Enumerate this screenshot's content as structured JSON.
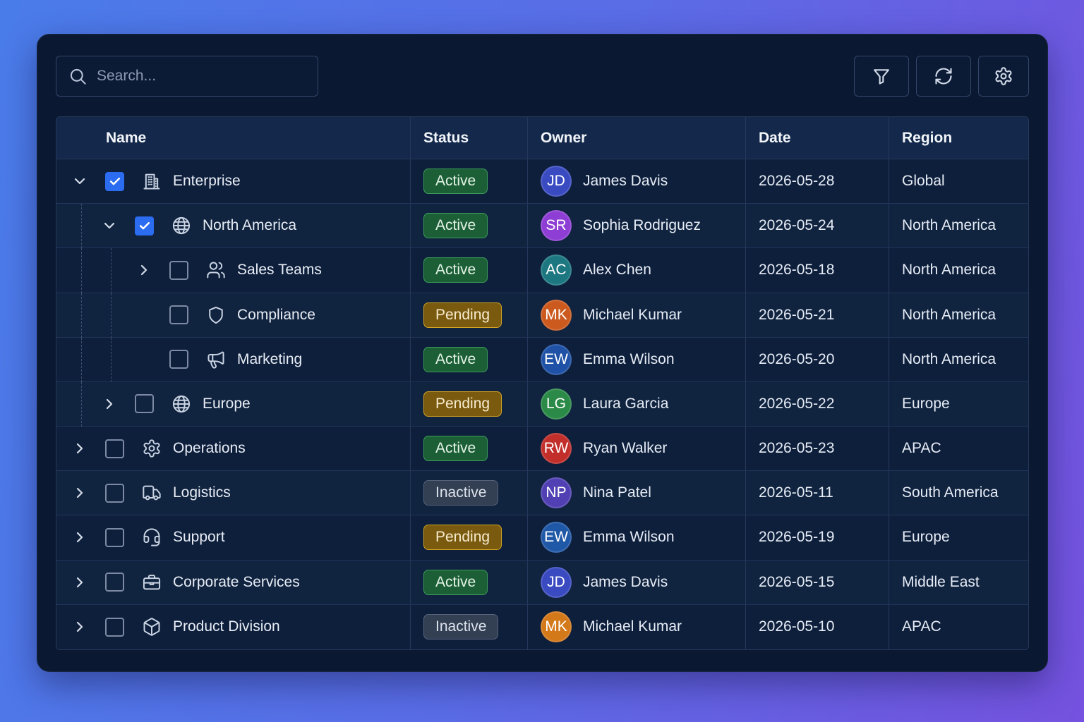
{
  "search": {
    "placeholder": "Search...",
    "icon": "search"
  },
  "toolbar": {
    "buttons": [
      {
        "icon": "filter"
      },
      {
        "icon": "refresh"
      },
      {
        "icon": "settings"
      }
    ]
  },
  "colors": {
    "accent": "#2b6cf0"
  },
  "status_styles": {
    "Active": {
      "background": "#1c5f36",
      "border": "#3c9a5a",
      "text": "#e3f2e6"
    },
    "Pending": {
      "background": "#7a5a0e",
      "border": "#d2a324",
      "text": "#f7ecd0"
    },
    "Inactive": {
      "background": "#333f52",
      "border": "#56627a",
      "text": "#dde3ec"
    }
  },
  "table": {
    "columns": [
      "Name",
      "Status",
      "Owner",
      "Date",
      "Region"
    ],
    "rows": [
      {
        "depth": 0,
        "expander": "expanded",
        "checked": true,
        "icon": "building",
        "name": "Enterprise",
        "status": "Active",
        "owner": {
          "initials": "JD",
          "name": "James Davis",
          "color": "#3a4bc2"
        },
        "date": "2026-05-28",
        "region": "Global"
      },
      {
        "depth": 1,
        "expander": "expanded",
        "checked": true,
        "icon": "globe",
        "name": "North America",
        "status": "Active",
        "owner": {
          "initials": "SR",
          "name": "Sophia Rodriguez",
          "color": "#8e3ed4"
        },
        "date": "2026-05-24",
        "region": "North America"
      },
      {
        "depth": 2,
        "expander": "collapsed",
        "checked": false,
        "icon": "users",
        "name": "Sales Teams",
        "status": "Active",
        "owner": {
          "initials": "AC",
          "name": "Alex Chen",
          "color": "#1d7780"
        },
        "date": "2026-05-18",
        "region": "North America"
      },
      {
        "depth": 2,
        "expander": "none",
        "checked": false,
        "icon": "shield",
        "name": "Compliance",
        "status": "Pending",
        "owner": {
          "initials": "MK",
          "name": "Michael Kumar",
          "color": "#cc5a1e"
        },
        "date": "2026-05-21",
        "region": "North America"
      },
      {
        "depth": 2,
        "expander": "none",
        "checked": false,
        "icon": "megaphone",
        "name": "Marketing",
        "status": "Active",
        "owner": {
          "initials": "EW",
          "name": "Emma Wilson",
          "color": "#1f52a6"
        },
        "date": "2026-05-20",
        "region": "North America"
      },
      {
        "depth": 1,
        "expander": "collapsed",
        "checked": false,
        "icon": "globe",
        "name": "Europe",
        "status": "Pending",
        "owner": {
          "initials": "LG",
          "name": "Laura Garcia",
          "color": "#2b8a47"
        },
        "date": "2026-05-22",
        "region": "Europe"
      },
      {
        "depth": 0,
        "expander": "collapsed",
        "checked": false,
        "icon": "gear",
        "name": "Operations",
        "status": "Active",
        "owner": {
          "initials": "RW",
          "name": "Ryan Walker",
          "color": "#c22f2b"
        },
        "date": "2026-05-23",
        "region": "APAC"
      },
      {
        "depth": 0,
        "expander": "collapsed",
        "checked": false,
        "icon": "truck",
        "name": "Logistics",
        "status": "Inactive",
        "owner": {
          "initials": "NP",
          "name": "Nina Patel",
          "color": "#5140b4"
        },
        "date": "2026-05-11",
        "region": "South America"
      },
      {
        "depth": 0,
        "expander": "collapsed",
        "checked": false,
        "icon": "headset",
        "name": "Support",
        "status": "Pending",
        "owner": {
          "initials": "EW",
          "name": "Emma Wilson",
          "color": "#2058a8"
        },
        "date": "2026-05-19",
        "region": "Europe"
      },
      {
        "depth": 0,
        "expander": "collapsed",
        "checked": false,
        "icon": "briefcase",
        "name": "Corporate Services",
        "status": "Active",
        "owner": {
          "initials": "JD",
          "name": "James Davis",
          "color": "#3a4bc2"
        },
        "date": "2026-05-15",
        "region": "Middle East"
      },
      {
        "depth": 0,
        "expander": "collapsed",
        "checked": false,
        "icon": "box",
        "name": "Product Division",
        "status": "Inactive",
        "owner": {
          "initials": "MK",
          "name": "Michael Kumar",
          "color": "#d4791a"
        },
        "date": "2026-05-10",
        "region": "APAC"
      }
    ]
  }
}
